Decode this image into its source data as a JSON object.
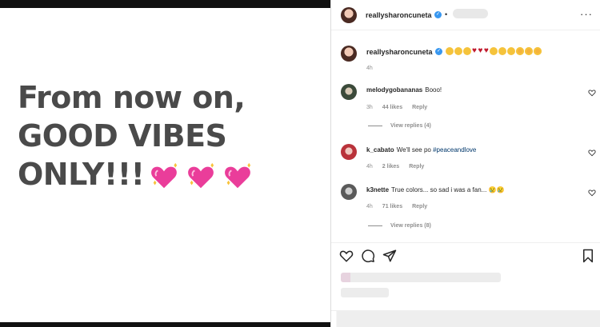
{
  "post": {
    "lines": [
      "From now on,",
      "GOOD VIBES",
      "ONLY!!!"
    ],
    "heart_emoji_count": 3
  },
  "header": {
    "username": "reallysharoncuneta",
    "verified_icon": "verified-check-icon",
    "separator": "•",
    "more_icon": "···"
  },
  "caption": {
    "username": "reallysharoncuneta",
    "time": "4h",
    "emojis": [
      "grin",
      "grin",
      "grin",
      "heart",
      "heart",
      "heart",
      "smile",
      "smile",
      "smile",
      "heart-eyes",
      "heart-eyes",
      "heart-eyes"
    ]
  },
  "comments": [
    {
      "username": "melodygobananas",
      "text": "Booo!",
      "time": "3h",
      "likes": "44 likes",
      "reply": "Reply",
      "view_replies": "View replies (4)"
    },
    {
      "username": "k_cabato",
      "text": "We'll see po ",
      "hashtag": "#peaceandlove",
      "time": "4h",
      "likes": "2 likes",
      "reply": "Reply"
    },
    {
      "username": "k3nette",
      "text": "True colors... so sad i was a fan... 😢😢",
      "time": "4h",
      "likes": "71 likes",
      "reply": "Reply",
      "view_replies": "View replies (8)"
    }
  ],
  "actions": {
    "icons": [
      "heart-icon",
      "comment-icon",
      "share-icon",
      "bookmark-icon"
    ]
  },
  "colors": {
    "text": "#262626",
    "muted": "#8e8e8e",
    "verified": "#3897f0",
    "post_text": "#4a4a4a",
    "hashtag": "#00376b"
  }
}
